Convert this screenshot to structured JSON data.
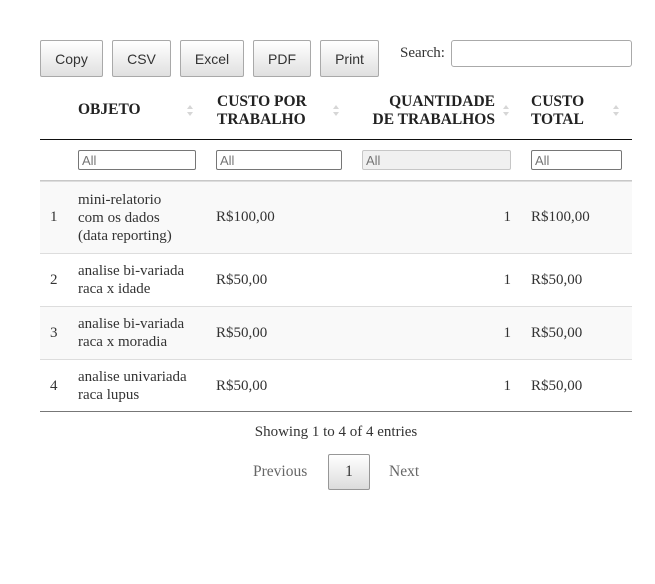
{
  "toolbar": {
    "copy": "Copy",
    "csv": "CSV",
    "excel": "Excel",
    "pdf": "PDF",
    "print": "Print"
  },
  "search": {
    "label": "Search:",
    "value": ""
  },
  "columns": {
    "objeto": "OBJETO",
    "custo_l1": "CUSTO POR",
    "custo_l2": "TRABALHO",
    "qtd_l1": "QUANTIDADE",
    "qtd_l2": "DE TRABALHOS",
    "total_l1": "CUSTO",
    "total_l2": "TOTAL"
  },
  "filters": {
    "placeholder": "All"
  },
  "rows": [
    {
      "idx": "1",
      "obj": [
        "mini-relatorio",
        "com os dados",
        "(data reporting)"
      ],
      "custo": "R$100,00",
      "qtd": "1",
      "total": "R$100,00"
    },
    {
      "idx": "2",
      "obj": [
        "analise bi-variada",
        "raca x idade"
      ],
      "custo": "R$50,00",
      "qtd": "1",
      "total": "R$50,00"
    },
    {
      "idx": "3",
      "obj": [
        "analise bi-variada",
        "raca x moradia"
      ],
      "custo": "R$50,00",
      "qtd": "1",
      "total": "R$50,00"
    },
    {
      "idx": "4",
      "obj": [
        "analise univariada",
        "raca lupus"
      ],
      "custo": "R$50,00",
      "qtd": "1",
      "total": "R$50,00"
    }
  ],
  "info": "Showing 1 to 4 of 4 entries",
  "pagination": {
    "previous": "Previous",
    "current": "1",
    "next": "Next"
  }
}
